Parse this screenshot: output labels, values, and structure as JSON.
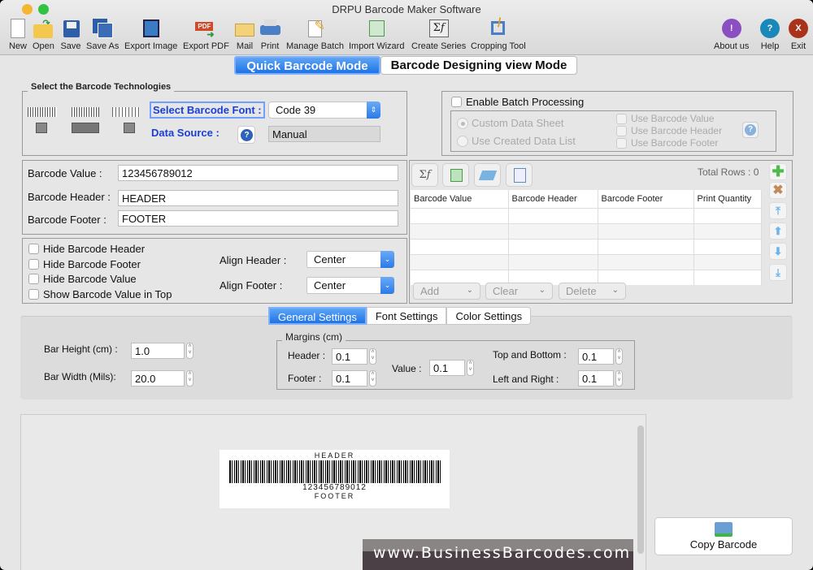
{
  "window": {
    "title": "DRPU Barcode Maker Software"
  },
  "toolbar": {
    "items": [
      {
        "label": "New",
        "icon": "new-document-icon"
      },
      {
        "label": "Open",
        "icon": "open-folder-icon"
      },
      {
        "label": "Save",
        "icon": "save-icon"
      },
      {
        "label": "Save As",
        "icon": "save-as-icon"
      },
      {
        "label": "Export Image",
        "icon": "export-image-icon"
      },
      {
        "label": "Export PDF",
        "icon": "export-pdf-icon"
      },
      {
        "label": "Mail",
        "icon": "mail-icon"
      },
      {
        "label": "Print",
        "icon": "printer-icon"
      },
      {
        "label": "Manage Batch",
        "icon": "manage-batch-icon"
      },
      {
        "label": "Import Wizard",
        "icon": "import-wizard-icon"
      },
      {
        "label": "Create Series",
        "icon": "sigma-function-icon"
      },
      {
        "label": "Cropping Tool",
        "icon": "crop-icon"
      },
      {
        "label": "About us",
        "icon": "info-icon"
      },
      {
        "label": "Help",
        "icon": "help-icon"
      },
      {
        "label": "Exit",
        "icon": "exit-icon"
      }
    ]
  },
  "modes": {
    "quick": "Quick Barcode Mode",
    "designing": "Barcode Designing view Mode",
    "active": "quick"
  },
  "technologies": {
    "group_label": "Select the Barcode Technologies",
    "font_label": "Select Barcode Font :",
    "font_value": "Code 39",
    "source_label": "Data Source :",
    "source_value": "Manual"
  },
  "batch": {
    "enable_label": "Enable Batch Processing",
    "enable_checked": false,
    "radio_custom": "Custom Data Sheet",
    "radio_created": "Use Created Data List",
    "use_value": "Use Barcode Value",
    "use_header": "Use Barcode Header",
    "use_footer": "Use Barcode Footer"
  },
  "fields": {
    "value_label": "Barcode Value :",
    "value": "123456789012",
    "header_label": "Barcode Header :",
    "header": "HEADER",
    "footer_label": "Barcode Footer :",
    "footer": "FOOTER"
  },
  "options": {
    "hide_header": "Hide Barcode Header",
    "hide_footer": "Hide Barcode Footer",
    "hide_value": "Hide Barcode Value",
    "show_value_top": "Show Barcode Value in Top",
    "align_header_label": "Align Header :",
    "align_header": "Center",
    "align_footer_label": "Align Footer :",
    "align_footer": "Center"
  },
  "table": {
    "total_rows": "Total Rows : 0",
    "columns": [
      "Barcode Value",
      "Barcode Header",
      "Barcode Footer",
      "Print Quantity"
    ],
    "rows": [],
    "add": "Add",
    "clear": "Clear",
    "delete": "Delete"
  },
  "settings_tabs": {
    "general": "General Settings",
    "font": "Font Settings",
    "color": "Color Settings",
    "active": "general"
  },
  "general": {
    "bar_height_label": "Bar Height (cm) :",
    "bar_height": "1.0",
    "bar_width_label": "Bar Width (Mils):",
    "bar_width": "20.0",
    "margins_label": "Margins (cm)",
    "header_label": "Header :",
    "header": "0.1",
    "footer_label": "Footer :",
    "footer": "0.1",
    "value_label": "Value :",
    "value": "0.1",
    "top_bottom_label": "Top and Bottom :",
    "top_bottom": "0.1",
    "left_right_label": "Left and Right :",
    "left_right": "0.1"
  },
  "preview": {
    "header": "HEADER",
    "value": "123456789012",
    "footer": "FOOTER"
  },
  "copy_button": "Copy Barcode",
  "watermark": "www.BusinessBarcodes.com"
}
